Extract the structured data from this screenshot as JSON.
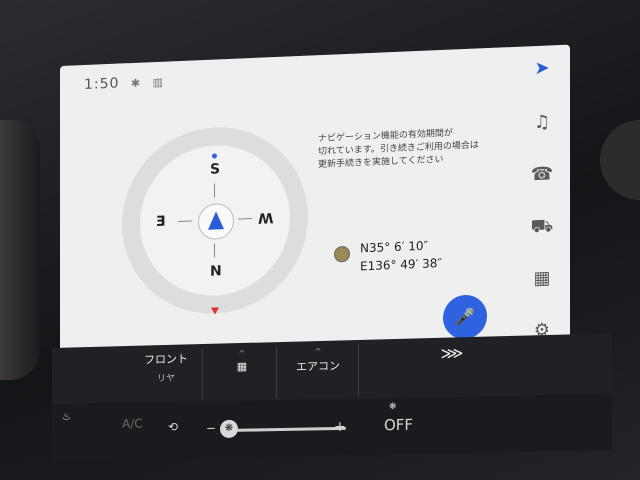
{
  "status": {
    "time": "1:50",
    "bluetooth_icon": "bluetooth-icon",
    "signal_icon": "signal-icon"
  },
  "compass": {
    "north": "N",
    "south": "S",
    "east": "E",
    "west": "W",
    "heading_icon": "heading-arrow-icon"
  },
  "message": {
    "line1": "ナビゲーション機能の有効期間が",
    "line2": "切れています。引き続きご利用の場合は",
    "line3": "更新手続きを実施してください"
  },
  "coordinates": {
    "lat": "N35° 6′ 10″",
    "lon": "E136° 49′ 38″"
  },
  "side_rail": [
    {
      "name": "navigation-icon",
      "glyph": "➤"
    },
    {
      "name": "music-icon",
      "glyph": "♫"
    },
    {
      "name": "phone-icon",
      "glyph": "☎"
    },
    {
      "name": "vehicle-icon",
      "glyph": "⛟"
    },
    {
      "name": "apps-icon",
      "glyph": "▦"
    },
    {
      "name": "settings-icon",
      "glyph": "⚙"
    }
  ],
  "mic": {
    "glyph": "🎤"
  },
  "bar": {
    "front_label": "フロント",
    "rear_label": "リヤ",
    "apps_glyph": "▦",
    "ac_label": "エアコン",
    "defrost_glyph": "⋙"
  },
  "controls": {
    "ac_toggle": "A/C",
    "minus": "−",
    "plus": "+",
    "fan_off": "OFF",
    "fan_glyph": "❋"
  },
  "accent": "#2f62e0"
}
